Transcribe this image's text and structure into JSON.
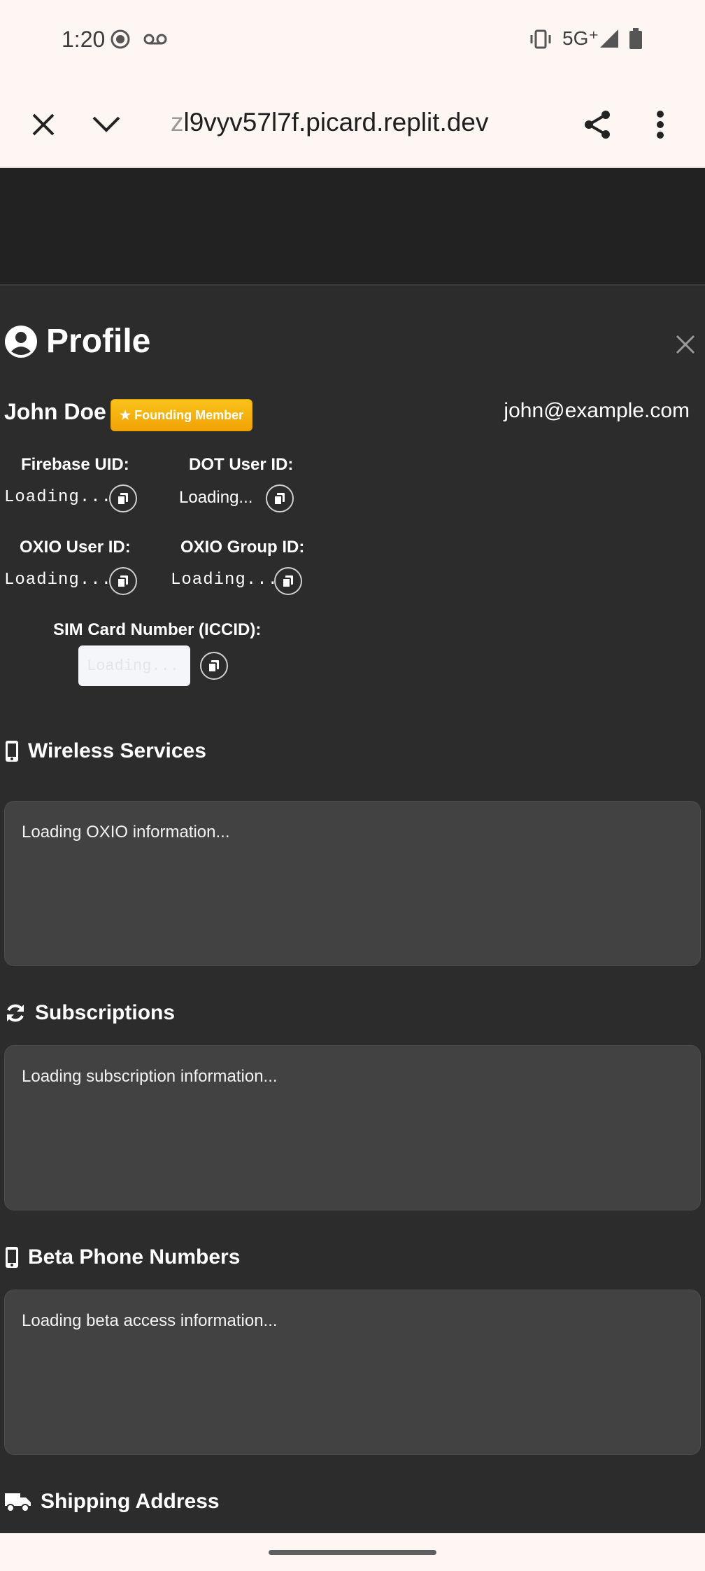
{
  "status": {
    "time": "1:20",
    "network": "5G⁺"
  },
  "browser": {
    "url_faded": "z",
    "url": "l9vyv57l7f.picard.replit.dev"
  },
  "profile": {
    "title": "Profile",
    "name": "John Doe",
    "badge": "★ Founding Member",
    "email": "john@example.com",
    "ids": {
      "firebase_label": "Firebase UID:",
      "firebase_value": "Loading...",
      "dot_label": "DOT User ID:",
      "dot_value": "Loading...",
      "oxio_user_label": "OXIO User ID:",
      "oxio_user_value": "Loading...",
      "oxio_group_label": "OXIO Group ID:",
      "oxio_group_value": "Loading...",
      "iccid_label": "SIM Card Number (ICCID):",
      "iccid_value": "Loading..."
    }
  },
  "sections": {
    "wireless": {
      "title": "Wireless Services",
      "text": "Loading OXIO information..."
    },
    "subscriptions": {
      "title": "Subscriptions",
      "text": "Loading subscription information..."
    },
    "beta": {
      "title": "Beta Phone Numbers",
      "text": "Loading beta access information..."
    },
    "shipping": {
      "title": "Shipping Address"
    }
  },
  "colors": {
    "badge": "#f5b30f",
    "panel_bg": "#2c2c2d",
    "card_bg": "#424243"
  }
}
